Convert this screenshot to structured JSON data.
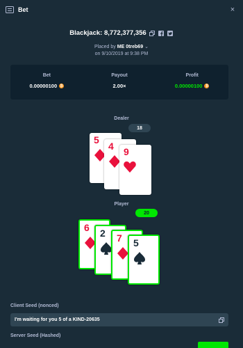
{
  "header": {
    "title": "Bet",
    "icon": "ticket-icon",
    "close_icon": "×"
  },
  "game": {
    "name": "Blackjack: 8,772,377,356"
  },
  "placed": {
    "prefix": "Placed by",
    "user": "ME 0treb69",
    "date": "on 9/10/2019 at 9:38 PM"
  },
  "stats": [
    {
      "label": "Bet",
      "value": "0.00000100"
    },
    {
      "label": "Payout",
      "value": "2.00×"
    },
    {
      "label": "Profit",
      "value": "0.00000100"
    }
  ],
  "coin_symbol": "₿",
  "dealer": {
    "label": "Dealer",
    "score": "18",
    "cards": [
      {
        "rank": "5",
        "suit": "diamond",
        "color": "red"
      },
      {
        "rank": "4",
        "suit": "diamond",
        "color": "red"
      },
      {
        "rank": "9",
        "suit": "heart",
        "color": "red"
      }
    ]
  },
  "player": {
    "label": "Player",
    "score": "20",
    "cards": [
      {
        "rank": "6",
        "suit": "diamond",
        "color": "red"
      },
      {
        "rank": "2",
        "suit": "spade",
        "color": "black"
      },
      {
        "rank": "7",
        "suit": "diamond",
        "color": "red"
      },
      {
        "rank": "5",
        "suit": "spade",
        "color": "black"
      }
    ]
  },
  "client_seed": {
    "label": "Client Seed (nonced)",
    "value": "I'm waiting for you 5 of a KIND-20635"
  },
  "server_seed": {
    "label": "Server Seed (Hashed)"
  },
  "colors": {
    "accent_green": "#00e701",
    "red": "#e9113c",
    "bg": "#1a2c38",
    "panel": "#0f212e"
  }
}
